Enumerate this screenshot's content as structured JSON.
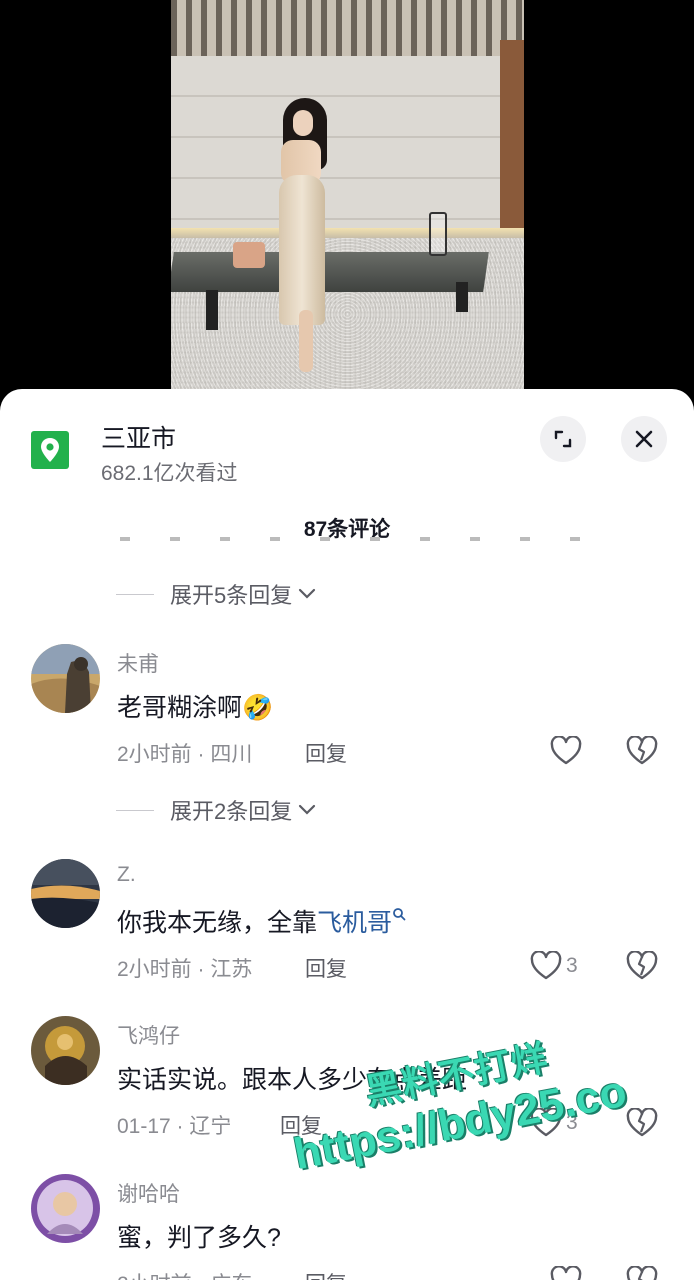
{
  "location": {
    "name": "三亚市",
    "views": "682.1亿次看过"
  },
  "comments_header": {
    "count_label": "87条评论"
  },
  "expand_rows": [
    {
      "label": "展开5条回复"
    },
    {
      "label": "展开2条回复"
    }
  ],
  "comments": [
    {
      "user": "未甫",
      "text": "老哥糊涂啊",
      "emoji": "🤣",
      "time_location": "2小时前 · 四川",
      "reply_label": "回复",
      "likes": ""
    },
    {
      "user": "Z.",
      "text": "你我本无缘，全靠",
      "link_text": "飞机哥",
      "time_location": "2小时前 · 江苏",
      "reply_label": "回复",
      "likes": "3"
    },
    {
      "user": "飞鸿仔",
      "text": "实话实说。跟本人多少有点差距",
      "time_location": "01-17 · 辽宁",
      "reply_label": "回复",
      "likes": "3"
    },
    {
      "user": "谢哈哈",
      "text": "蜜，判了多久?",
      "time_location": "2小时前 · 广东",
      "reply_label": "回复",
      "likes": ""
    }
  ],
  "watermark": {
    "line1": "黑料不打烊",
    "line2": "https://bdy25.co"
  },
  "icons": {
    "location": "map-pin-icon",
    "expand": "expand-corner-icon",
    "close": "close-icon",
    "chevron": "chevron-down-icon",
    "like": "heart-outline-icon",
    "dislike": "broken-heart-icon",
    "search_link": "search-icon"
  },
  "colors": {
    "location_icon": "#22b14c",
    "link": "#2b5c9e",
    "watermark": "#3ad8b3"
  }
}
